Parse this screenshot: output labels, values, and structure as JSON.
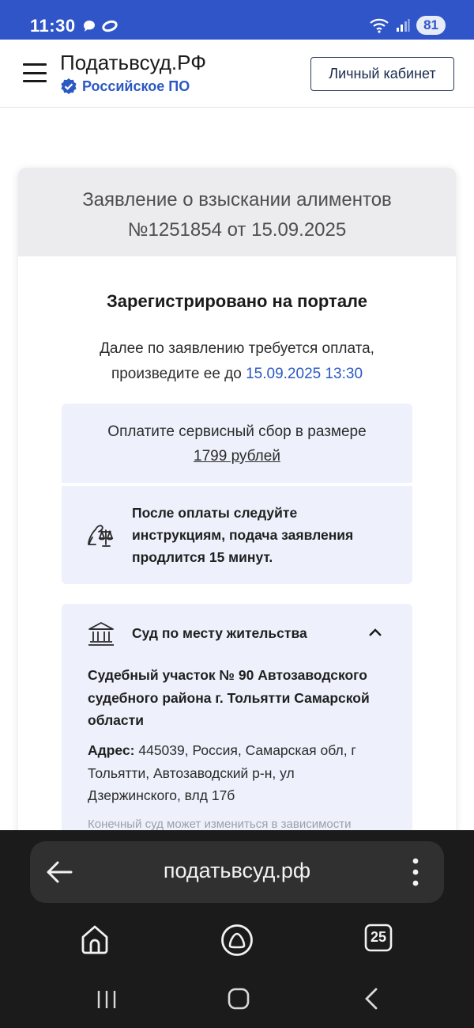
{
  "status_bar": {
    "time": "11:30",
    "battery": "81",
    "icons": [
      "chat-bubble-icon",
      "ring-icon",
      "wifi-icon",
      "signal-icon"
    ]
  },
  "header": {
    "title": "Податьвсуд.РФ",
    "subtitle": "Российское ПО",
    "cabinet_button": "Личный кабинет",
    "menu_icon": "hamburger-menu-icon",
    "verified_icon": "verified-check-icon"
  },
  "application": {
    "title_line1": "Заявление о взыскании алиментов",
    "title_line2": "№1251854 от 15.09.2025",
    "status": "Зарегистрировано на портале",
    "payment_note_line1": "Далее по заявлению требуется оплата,",
    "payment_note_line2_prefix": "произведите ее до ",
    "payment_deadline": "15.09.2025 13:30"
  },
  "fee": {
    "text": "Оплатите сервисный сбор в размере",
    "amount": "1799 рублей"
  },
  "after_payment": {
    "icon": "scales-justice-icon",
    "line1": "После оплаты следуйте",
    "line2": "инструкциям, подача заявления",
    "line3": "продлится 15 минут."
  },
  "court": {
    "icon": "courthouse-icon",
    "label": "Суд по месту жительства",
    "expanded": true,
    "name_line1": "Судебный участок № 90 Автозаводского",
    "name_line2": "судебного района г. Тольятти Самарской",
    "name_line3": "области",
    "address_label": "Адрес:",
    "address_line1": " 445039, Россия, Самарская обл, г",
    "address_line2": "Тольятти, Автозаводский р-н, ул",
    "address_line3": "Дзержинского, влд 17б",
    "hint": "Конечный суд может измениться в зависимости"
  },
  "browser": {
    "url": "податьвсуд.рф",
    "tabs_count": "25"
  },
  "colors": {
    "status_bar": "#2f55c8",
    "accent": "#2b59c3",
    "box_bg": "#eef1fb",
    "card_header_bg": "#ececef",
    "browser_bg": "#1b1b1b"
  }
}
